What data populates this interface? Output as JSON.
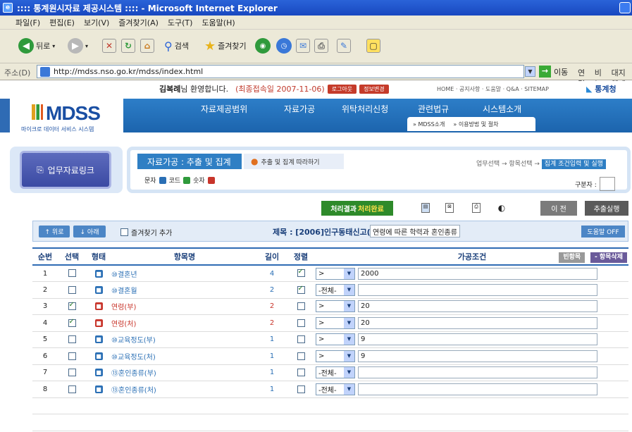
{
  "window": {
    "title": ":::: 통계원시자료 제공시스템 :::: - Microsoft Internet Explorer"
  },
  "menu": [
    "파일(F)",
    "편집(E)",
    "보기(V)",
    "즐겨찾기(A)",
    "도구(T)",
    "도움말(H)"
  ],
  "toolbar": {
    "back": "뒤로",
    "search": "검색",
    "favorites": "즐겨찾기"
  },
  "address": {
    "label": "주소(D)",
    "url": "http://mdss.nso.go.kr/mdss/index.html",
    "go": "이동",
    "links_label": "연결",
    "link1": "비누",
    "link2": "대지웹메일"
  },
  "header": {
    "user": "김복례",
    "welcome": "님 환영합니다.",
    "last_login": "(최종접속일 2007-11-06)",
    "logout": "로그아웃",
    "info_change": "정보변경",
    "top_links": "HOME · 공지사항 · 도움말 · Q&A · SITEMAP",
    "org": "통계청",
    "logo": "MDSS",
    "logo_sub": "마이크로 데이터 서비스 시스템"
  },
  "nav": {
    "items": [
      "자료제공범위",
      "자료가공",
      "위탁처리신청",
      "관련법규",
      "시스템소개"
    ],
    "sub": [
      "» MDSS소개",
      "» 이용방법 및 절차"
    ]
  },
  "quick": {
    "label": "업무자료링크"
  },
  "process": {
    "tab_active": "자료가공 : 추출 및 집계",
    "tab_follow": "추출 및 집계 따라하기",
    "legend": [
      "문자",
      "코드",
      "숫자"
    ],
    "steps": [
      "업무선택",
      "항목선택",
      "집계 조건입력 및 실행"
    ],
    "gubun_label": "구분자 :"
  },
  "actions": {
    "status_label": "처리결과",
    "status_value": "처리완료",
    "prev": "이 전",
    "run": "추출실행"
  },
  "info": {
    "up": "↑ 위로",
    "down": "↓ 아래",
    "fav": "즐겨찾기 추가",
    "title_label": "제목 : [2006]인구동태신고(VB)",
    "title_value": "연령에 따른 학력과 혼인종류",
    "help_off": "도움말 OFF"
  },
  "table": {
    "headers": [
      "순번",
      "선택",
      "형태",
      "항목명",
      "길이",
      "정렬",
      "가공조건"
    ],
    "empty_btn": "빈항목",
    "del_btn": "- 항목삭제",
    "rows": [
      {
        "no": "1",
        "checked": false,
        "type": "T",
        "name": "⑩결혼년",
        "len": "4",
        "sort": true,
        "op": ">",
        "val": "2000",
        "nameColor": "blue"
      },
      {
        "no": "2",
        "checked": false,
        "type": "T",
        "name": "⑩결혼월",
        "len": "2",
        "sort": true,
        "op": "-전체-",
        "val": "",
        "nameColor": "blue"
      },
      {
        "no": "3",
        "checked": true,
        "type": "N",
        "name": "연령(부)",
        "len": "2",
        "sort": false,
        "op": ">",
        "val": "20",
        "nameColor": "red"
      },
      {
        "no": "4",
        "checked": true,
        "type": "N",
        "name": "연령(처)",
        "len": "2",
        "sort": false,
        "op": ">",
        "val": "20",
        "nameColor": "red"
      },
      {
        "no": "5",
        "checked": false,
        "type": "T",
        "name": "⑩교육정도(부)",
        "len": "1",
        "sort": false,
        "op": ">",
        "val": "9",
        "nameColor": "blue"
      },
      {
        "no": "6",
        "checked": false,
        "type": "T",
        "name": "⑩교육정도(처)",
        "len": "1",
        "sort": false,
        "op": ">",
        "val": "9",
        "nameColor": "blue"
      },
      {
        "no": "7",
        "checked": false,
        "type": "T",
        "name": "⑬혼인종류(부)",
        "len": "1",
        "sort": false,
        "op": "-전체-",
        "val": "",
        "nameColor": "blue"
      },
      {
        "no": "8",
        "checked": false,
        "type": "T",
        "name": "⑬혼인종류(처)",
        "len": "1",
        "sort": false,
        "op": "-전체-",
        "val": "",
        "nameColor": "blue"
      }
    ]
  }
}
